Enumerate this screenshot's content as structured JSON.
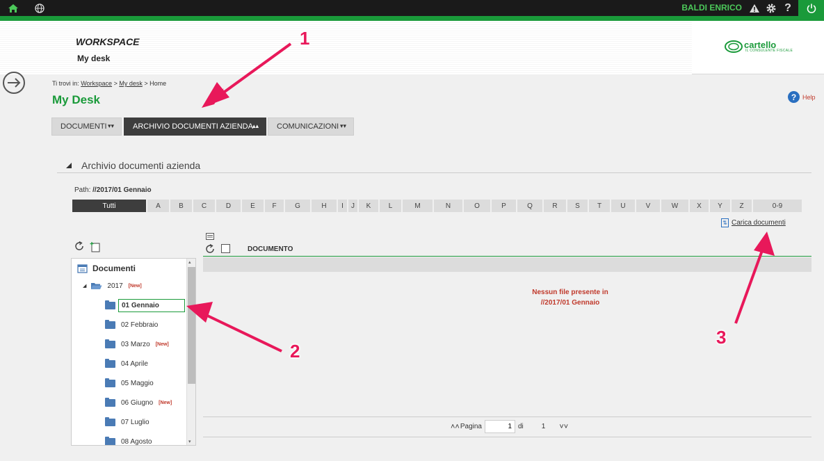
{
  "topbar": {
    "user_name": "BALDI ENRICO"
  },
  "header": {
    "title": "WORKSPACE",
    "subtitle": "My desk",
    "logo_text": "cartello",
    "logo_sub": "IL CONSULENTE FISCALE"
  },
  "breadcrumb": {
    "prefix": "Ti trovi in:",
    "items": [
      "Workspace",
      "My desk",
      "Home"
    ],
    "separator": ">"
  },
  "page_title": "My Desk",
  "help_label": "Help",
  "tabs": [
    {
      "label": "DOCUMENTI"
    },
    {
      "label": "ARCHIVIO DOCUMENTI AZIENDA"
    },
    {
      "label": "COMUNICAZIONI"
    }
  ],
  "section_title": "Archivio documenti azienda",
  "path": {
    "label": "Path:",
    "value": "//2017/01 Gennaio"
  },
  "alphabet": [
    "Tutti",
    "A",
    "B",
    "C",
    "D",
    "E",
    "F",
    "G",
    "H",
    "I",
    "J",
    "K",
    "L",
    "M",
    "N",
    "O",
    "P",
    "Q",
    "R",
    "S",
    "T",
    "U",
    "V",
    "W",
    "X",
    "Y",
    "Z",
    "0-9"
  ],
  "upload_label": "Carica documenti",
  "tree": {
    "root": "Documenti",
    "year": "2017",
    "new_badge": "[New]",
    "months": [
      {
        "label": "01 Gennaio"
      },
      {
        "label": "02 Febbraio"
      },
      {
        "label": "03 Marzo"
      },
      {
        "label": "04 Aprile"
      },
      {
        "label": "05 Maggio"
      },
      {
        "label": "06 Giugno"
      },
      {
        "label": "07 Luglio"
      },
      {
        "label": "08 Agosto"
      }
    ]
  },
  "doc_list": {
    "column": "DOCUMENTO",
    "empty_line1": "Nessun file presente in",
    "empty_line2": "//2017/01 Gennaio"
  },
  "pager": {
    "label": "Pagina",
    "current": "1",
    "of_label": "di",
    "total": "1"
  },
  "annotations": [
    "1",
    "2",
    "3"
  ],
  "colors": {
    "accent": "#1a9a3a",
    "dark": "#3d3d3d",
    "annotation": "#e8185a",
    "warning": "#c0392b"
  }
}
